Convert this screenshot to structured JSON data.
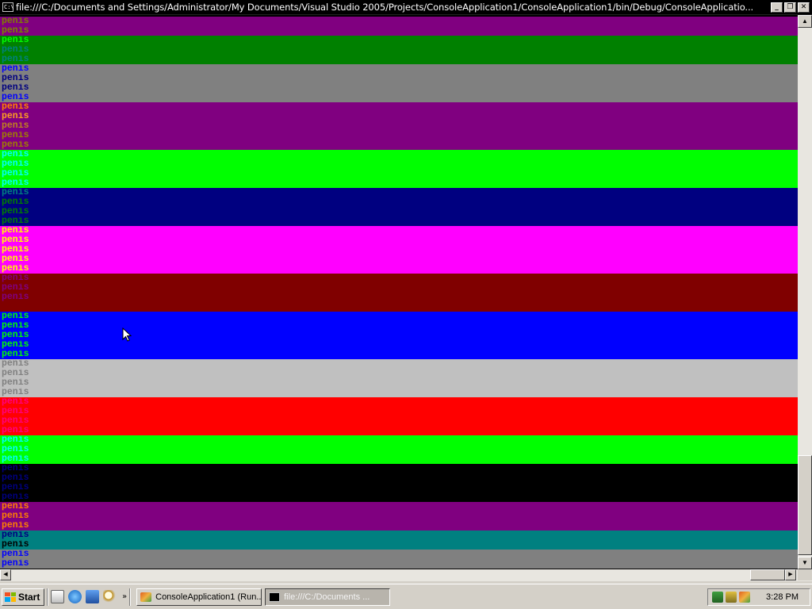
{
  "window": {
    "title": "file:///C:/Documents and Settings/Administrator/My Documents/Visual Studio 2005/Projects/ConsoleApplication1/ConsoleApplication1/bin/Debug/ConsoleApplicatio...",
    "icon": "console-icon",
    "icon_text": "C:\\",
    "minimize_glyph": "_",
    "maximize_glyph": "❐",
    "close_glyph": "✕"
  },
  "console": {
    "word": "penis",
    "bands": [
      {
        "bg": "#800080",
        "rows": 1,
        "fg": [
          "#808000"
        ]
      },
      {
        "bg": "#008000",
        "rows": 3,
        "fg": [
          "#00ff00",
          "#008080",
          "#008080"
        ]
      },
      {
        "bg": "#808080",
        "rows": 4,
        "fg": [
          "#0000ff",
          "#000080",
          "#000080",
          "#0000ff"
        ]
      },
      {
        "bg": "#800080",
        "rows": 5,
        "fg": [
          "#ff8000",
          "#ffa020",
          "#c08020",
          "#a08000",
          "#a08000"
        ]
      },
      {
        "bg": "#00ff00",
        "rows": 4,
        "fg": [
          "#00ffff",
          "#00ffff",
          "#00ffff",
          "#00ffff"
        ]
      },
      {
        "bg": "#000080",
        "rows": 4,
        "fg": [
          "#008080",
          "#008000",
          "#008000",
          "#008000"
        ]
      },
      {
        "bg": "#ff00ff",
        "rows": 5,
        "fg": [
          "#ffff00",
          "#ffff00",
          "#ffff00",
          "#ffff00",
          "#ffff00"
        ]
      },
      {
        "bg": "#800000",
        "rows": 4,
        "fg": [
          "#800080",
          "#800080",
          "#800080",
          "#800000"
        ]
      },
      {
        "bg": "#0000ff",
        "rows": 5,
        "fg": [
          "#00ff00",
          "#00ff00",
          "#00ff00",
          "#00ff00",
          "#00ff00"
        ]
      },
      {
        "bg": "#c0c0c0",
        "rows": 4,
        "fg": [
          "#808080",
          "#808080",
          "#808080",
          "#808080"
        ]
      },
      {
        "bg": "#ff0000",
        "rows": 4,
        "fg": [
          "#ff0080",
          "#ff0080",
          "#ff0080",
          "#ff0080"
        ]
      },
      {
        "bg": "#00ff00",
        "rows": 3,
        "fg": [
          "#00ffff",
          "#00ffff",
          "#00ffff"
        ]
      },
      {
        "bg": "#000000",
        "rows": 4,
        "fg": [
          "#000080",
          "#000080",
          "#000080",
          "#000080"
        ]
      },
      {
        "bg": "#800080",
        "rows": 3,
        "fg": [
          "#ff8000",
          "#ff8000",
          "#ff8000"
        ]
      },
      {
        "bg": "#008080",
        "rows": 2,
        "fg": [
          "#000080",
          "#000000"
        ]
      },
      {
        "bg": "#808080",
        "rows": 2,
        "fg": [
          "#0000ff",
          "#0000ff"
        ]
      }
    ],
    "first_line_bg": "#800080",
    "first_line_fg": "#808000"
  },
  "scrollbars": {
    "up_glyph": "▲",
    "down_glyph": "▼",
    "left_glyph": "◀",
    "right_glyph": "▶"
  },
  "taskbar": {
    "start_label": "Start",
    "quicklaunch": [
      "desktop-icon",
      "ie-icon",
      "outlook-icon",
      "search-icon"
    ],
    "more_glyph": "»",
    "tasks": [
      {
        "label": "ConsoleApplication1 (Run...",
        "icon": "visual-studio-icon",
        "active": false
      },
      {
        "label": "file:///C:/Documents ...",
        "icon": "console-icon",
        "active": true
      }
    ],
    "tray_icons": [
      "network-icon",
      "volume-icon",
      "vs-icon"
    ],
    "clock": "3:28 PM"
  }
}
